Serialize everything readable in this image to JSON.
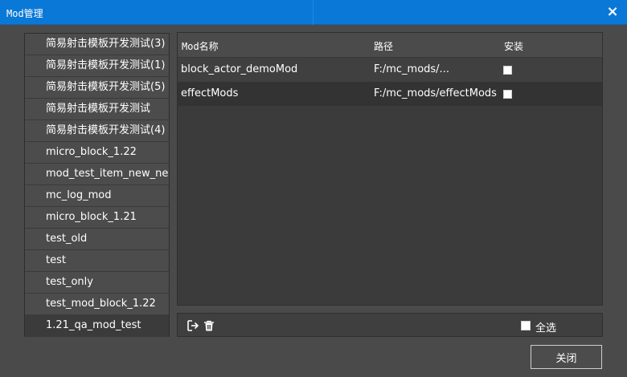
{
  "window": {
    "title": "Mod管理",
    "close_icon": "×"
  },
  "left_list": {
    "items": [
      "简易射击模板开发测试(3)",
      "简易射击模板开发测试(1)",
      "简易射击模板开发测试(5)",
      "简易射击模板开发测试",
      "简易射击模板开发测试(4)",
      "micro_block_1.22",
      "mod_test_item_new_new",
      "mc_log_mod",
      "micro_block_1.21",
      "test_old",
      "test",
      "test_only",
      "test_mod_block_1.22",
      "1.21_qa_mod_test"
    ]
  },
  "table": {
    "headers": [
      "Mod名称",
      "路径",
      "安装"
    ],
    "rows": [
      {
        "name": "block_actor_demoMod",
        "path": "F:/mc_mods/...",
        "installed": false
      },
      {
        "name": "effectMods",
        "path": "F:/mc_mods/effectMods",
        "installed": false
      }
    ]
  },
  "toolbar": {
    "export_icon": "export-icon",
    "delete_icon": "trash-icon",
    "select_all_label": "全选"
  },
  "footer": {
    "close_label": "关闭"
  },
  "colors": {
    "titlebar": "#0a78d7",
    "background": "#4a4a4a",
    "panel": "#3b3b3b"
  }
}
